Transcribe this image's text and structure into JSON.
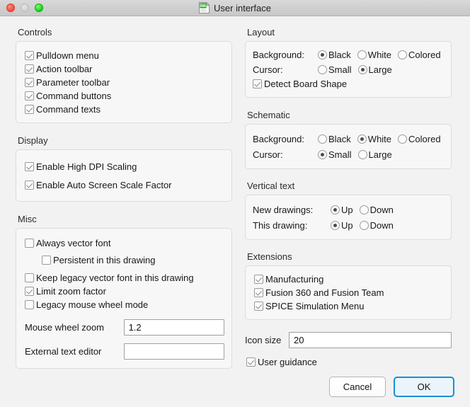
{
  "window": {
    "title": "User interface",
    "icon": "board-document-icon",
    "traffic_lights": [
      "close-red",
      "minimize-gray",
      "zoom-green"
    ]
  },
  "left": {
    "controls": {
      "title": "Controls",
      "items": [
        {
          "label": "Pulldown menu",
          "checked": true
        },
        {
          "label": "Action toolbar",
          "checked": true
        },
        {
          "label": "Parameter toolbar",
          "checked": true
        },
        {
          "label": "Command buttons",
          "checked": true
        },
        {
          "label": "Command texts",
          "checked": true
        }
      ]
    },
    "display": {
      "title": "Display",
      "items": [
        {
          "label": "Enable High DPI Scaling",
          "checked": true
        },
        {
          "label": "Enable Auto Screen Scale Factor",
          "checked": true
        }
      ]
    },
    "misc": {
      "title": "Misc",
      "items": [
        {
          "label": "Always vector font",
          "checked": false,
          "indent": false
        },
        {
          "label": "Persistent in this drawing",
          "checked": false,
          "indent": true
        },
        {
          "label": "Keep legacy vector font in this drawing",
          "checked": false,
          "indent": false
        },
        {
          "label": "Limit zoom factor",
          "checked": true,
          "indent": false
        },
        {
          "label": "Legacy mouse wheel mode",
          "checked": false,
          "indent": false
        }
      ],
      "mouse_wheel_zoom": {
        "label": "Mouse wheel zoom",
        "value": "1.2"
      },
      "external_text_editor": {
        "label": "External text editor",
        "value": ""
      }
    }
  },
  "right": {
    "layout": {
      "title": "Layout",
      "background": {
        "label": "Background:",
        "options": [
          "Black",
          "White",
          "Colored"
        ],
        "selected": "Black"
      },
      "cursor": {
        "label": "Cursor:",
        "options": [
          "Small",
          "Large"
        ],
        "selected": "Large"
      },
      "detect_board_shape": {
        "label": "Detect Board Shape",
        "checked": true
      }
    },
    "schematic": {
      "title": "Schematic",
      "background": {
        "label": "Background:",
        "options": [
          "Black",
          "White",
          "Colored"
        ],
        "selected": "White"
      },
      "cursor": {
        "label": "Cursor:",
        "options": [
          "Small",
          "Large"
        ],
        "selected": "Small"
      }
    },
    "vertical_text": {
      "title": "Vertical text",
      "new_drawings": {
        "label": "New drawings:",
        "options": [
          "Up",
          "Down"
        ],
        "selected": "Up"
      },
      "this_drawing": {
        "label": "This drawing:",
        "options": [
          "Up",
          "Down"
        ],
        "selected": "Up"
      }
    },
    "extensions": {
      "title": "Extensions",
      "items": [
        {
          "label": "Manufacturing",
          "checked": true
        },
        {
          "label": "Fusion 360 and Fusion Team",
          "checked": true
        },
        {
          "label": "SPICE Simulation Menu",
          "checked": true
        }
      ]
    },
    "icon_size": {
      "label": "Icon size",
      "value": "20"
    },
    "user_guidance": {
      "label": "User guidance",
      "checked": true
    }
  },
  "buttons": {
    "cancel": "Cancel",
    "ok": "OK"
  },
  "colors": {
    "window_bg": "#f2f2f2",
    "group_bg": "#f7f7f7",
    "group_border": "#dcdcdc",
    "accent_blue": "#1a8fd8",
    "ok_fill": "#eaf4fb",
    "titlebar": "#cfcfcf"
  }
}
